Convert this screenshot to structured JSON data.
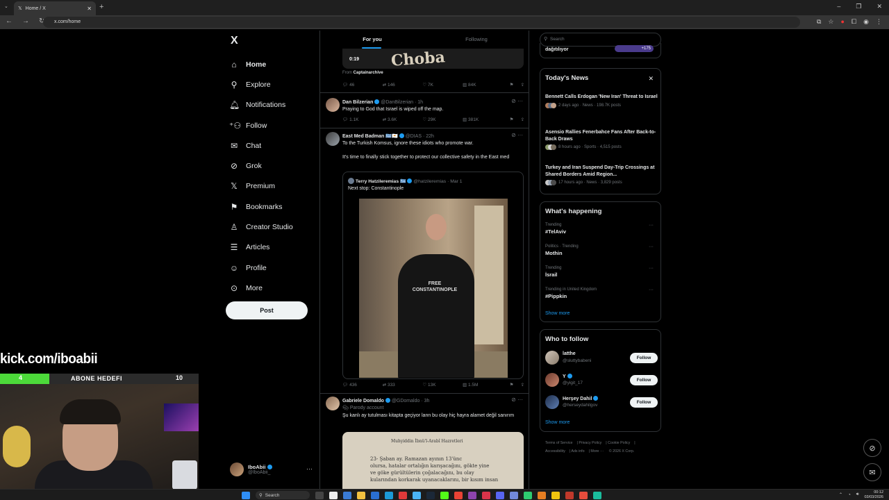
{
  "browser": {
    "tab_title": "Home / X",
    "url": "x.com/home"
  },
  "nav": {
    "logo": "X",
    "items": [
      {
        "label": "Home",
        "icon": "home-icon"
      },
      {
        "label": "Explore",
        "icon": "search-icon"
      },
      {
        "label": "Notifications",
        "icon": "bell-icon"
      },
      {
        "label": "Follow",
        "icon": "add-person-icon"
      },
      {
        "label": "Chat",
        "icon": "mail-icon"
      },
      {
        "label": "Grok",
        "icon": "grok-icon"
      },
      {
        "label": "Premium",
        "icon": "x-premium-icon"
      },
      {
        "label": "Bookmarks",
        "icon": "bookmark-icon"
      },
      {
        "label": "Creator Studio",
        "icon": "creator-icon"
      },
      {
        "label": "Articles",
        "icon": "article-icon"
      },
      {
        "label": "Profile",
        "icon": "profile-icon"
      },
      {
        "label": "More",
        "icon": "more-circle-icon"
      }
    ],
    "post_label": "Post",
    "account": {
      "name": "IboAbii",
      "handle": "@IboAbii_",
      "more": "···"
    }
  },
  "feed": {
    "tabs": [
      "For you",
      "Following"
    ],
    "video": {
      "duration": "0:19",
      "overlay_text": "Choba",
      "from_prefix": "From",
      "from_account": "Captainarchive"
    },
    "tweets": [
      {
        "name": "Dan Bilzerian",
        "handle": "@DanBilzerian · 1h",
        "text": "Praying to God that Israel is wiped off the map.",
        "stats": {
          "replies": "1.1K",
          "reposts": "3.6K",
          "likes": "29K",
          "views": "381K"
        }
      },
      {
        "name": "East Med Badman 🇬🇷🇨🇾",
        "handle": "@DIAS · 22h",
        "text1": "To the Turkish Komsus, ignore these idiots who promote war.",
        "text2": "It's time to finally stick together to protect our collective safety in the East med",
        "quote": {
          "name": "Terry Hatzileremias 🇬🇷",
          "handle": "@hatzileremias · Mar 1",
          "text": "Next stop: Constantinople",
          "shirt_text": "FREE\nCONSTANTINOPLE"
        },
        "stats": {
          "replies": "436",
          "reposts": "333",
          "likes": "13K",
          "views": "1.5M"
        }
      },
      {
        "name": "Gabriele Domaldo",
        "handle": "@GDomaldo · 3h",
        "label": "Parody account",
        "text": "Şu kanlı ay tutulması kitapta geçiyor lann bu olay hiç hayra alamet değil sanırım",
        "book_title": "Muhyiddin İbnü'l-Arabî Hazretleri",
        "book_text": "23- Şaban ay. Ramazan ayının 13'ünc<br>olursa, hatalar ortalığın karışacağını, gökte yine<br>ve göke gürültülerin çoğalacağını, bu olay<br>kularından korkarak uyanacaklarını, bir kısım insan"
      }
    ],
    "first_stats": {
      "replies": "46",
      "reposts": "146",
      "likes": "7K",
      "views": "84K"
    }
  },
  "right": {
    "search_placeholder": "Search",
    "top_card_text": "dağıtılıyor",
    "top_badge": "+175",
    "news_title": "Today's News",
    "news": [
      {
        "headline": "Bennett Calls Erdogan 'New Iran' Threat to Israel",
        "meta": "2 days ago · News · 198.7K posts"
      },
      {
        "headline": "Asensio Rallies Fenerbahce Fans After Back-to-Back Draws",
        "meta": "8 hours ago · Sports · 4,515 posts"
      },
      {
        "headline": "Turkey and Iran Suspend Day-Trip Crossings at Shared Borders Amid Region...",
        "meta": "17 hours ago · News · 3,829 posts"
      }
    ],
    "happening_title": "What's happening",
    "trends": [
      {
        "category": "Trending",
        "name": "#TelAviv"
      },
      {
        "category": "Politics · Trending",
        "name": "Mothin"
      },
      {
        "category": "Trending",
        "name": "İsrail"
      },
      {
        "category": "Trending in United Kingdom",
        "name": "#Pippkin"
      }
    ],
    "show_more": "Show more",
    "who_title": "Who to follow",
    "who": [
      {
        "name": "latthe",
        "handle": "@sluttybabeni"
      },
      {
        "name": "Y",
        "handle": "@yigit_17"
      },
      {
        "name": "Herşey Dahil",
        "handle": "@herseydahilgov"
      }
    ],
    "follow_label": "Follow",
    "footer": [
      "Terms of Service",
      "Privacy Policy",
      "Cookie Policy",
      "Accessibility",
      "Ads info",
      "More ···",
      "© 2026 X Corp."
    ]
  },
  "overlay": {
    "kick_url": "kick.com/iboabii",
    "sub_goal_current": "4",
    "sub_goal_label": "ABONE HEDEFI",
    "sub_goal_target": "10",
    "sub_goal_progress": 0.4
  },
  "taskbar": {
    "search_label": "Search",
    "time": "00:12",
    "date": "03/03/2026"
  }
}
